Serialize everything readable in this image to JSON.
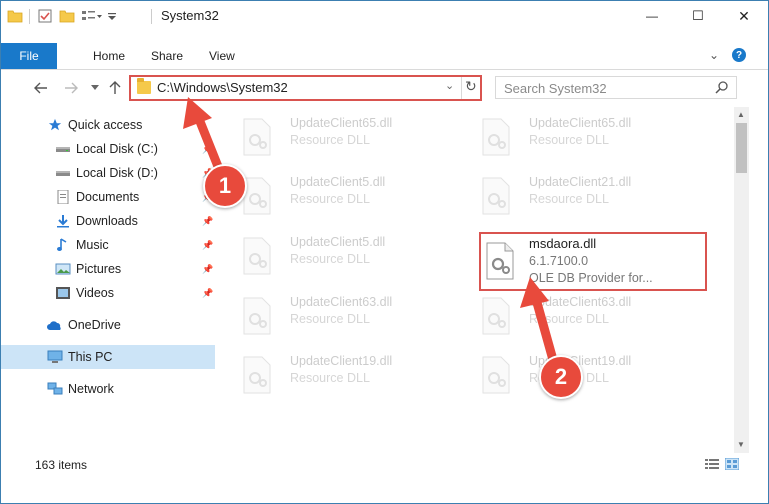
{
  "window": {
    "title": "System32",
    "controls": {
      "minimize": "—",
      "maximize": "☐",
      "close": "✕"
    }
  },
  "ribbon": {
    "tabs": [
      {
        "label": "File"
      },
      {
        "label": "Home"
      },
      {
        "label": "Share"
      },
      {
        "label": "View"
      }
    ],
    "help": "?"
  },
  "address_bar": {
    "path": "C:\\Windows\\System32"
  },
  "search": {
    "placeholder": "Search System32"
  },
  "nav": {
    "items": [
      {
        "label": "Quick access",
        "icon": "star-icon"
      },
      {
        "label": "Local Disk (C:)",
        "icon": "drive-icon",
        "pinned": true
      },
      {
        "label": "Local Disk (D:)",
        "icon": "drive-icon",
        "pinned": true
      },
      {
        "label": "Documents",
        "icon": "documents-icon",
        "pinned": true
      },
      {
        "label": "Downloads",
        "icon": "downloads-icon",
        "pinned": true
      },
      {
        "label": "Music",
        "icon": "music-icon",
        "pinned": true
      },
      {
        "label": "Pictures",
        "icon": "pictures-icon",
        "pinned": true
      },
      {
        "label": "Videos",
        "icon": "videos-icon",
        "pinned": true
      },
      {
        "label": "OneDrive",
        "icon": "onedrive-icon"
      },
      {
        "label": "This PC",
        "icon": "pc-icon",
        "selected": true
      },
      {
        "label": "Network",
        "icon": "network-icon"
      }
    ]
  },
  "files": {
    "left": [
      {
        "name": "UpdateClient65.dll",
        "desc": "Resource DLL"
      },
      {
        "name": "UpdateClient5.dll",
        "desc": "Resource DLL"
      },
      {
        "name": "UpdateClient5.dll",
        "desc": "Resource DLL"
      },
      {
        "name": "UpdateClient63.dll",
        "desc": "Resource DLL"
      },
      {
        "name": "UpdateClient19.dll",
        "desc": "Resource DLL"
      }
    ],
    "right": [
      {
        "name": "UpdateClient65.dll",
        "desc": "Resource DLL"
      },
      {
        "name": "UpdateClient21.dll",
        "desc": "Resource DLL"
      },
      {
        "name": "UpdateClient63.dll",
        "desc": "Resource DLL"
      },
      {
        "name": "UpdateClient19.dll",
        "desc": "Resource DLL"
      }
    ],
    "highlighted": {
      "name": "msdaora.dll",
      "version": "6.1.7100.0",
      "description": "OLE DB Provider for..."
    }
  },
  "status": {
    "item_count": "163 items"
  },
  "annotations": {
    "step1": "1",
    "step2": "2",
    "color": "#e84a3c"
  }
}
